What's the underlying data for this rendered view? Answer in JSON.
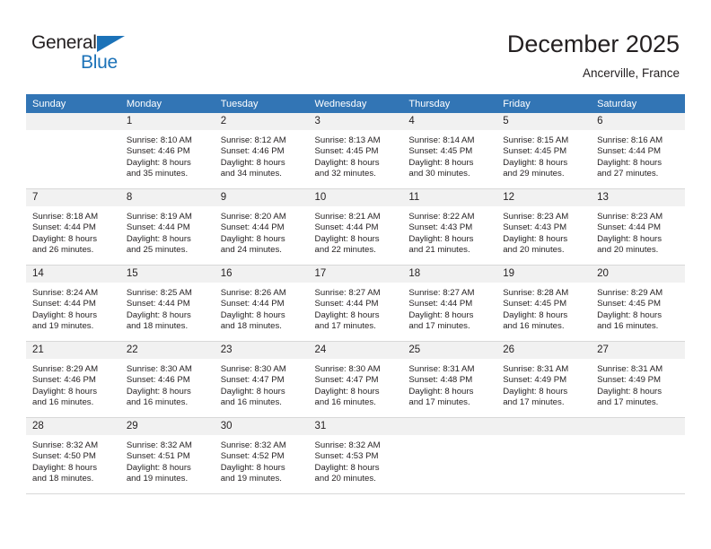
{
  "brand": {
    "name_part1": "General",
    "name_part2": "Blue",
    "triangle_color": "#1b72b8",
    "text_color": "#231f20"
  },
  "header": {
    "month_title": "December 2025",
    "location": "Ancerville, France"
  },
  "theme": {
    "header_row_bg": "#3275b5",
    "header_row_text": "#ffffff",
    "daynum_bg": "#f1f1f1",
    "grid_line": "#d8d8d8",
    "body_text": "#231f20"
  },
  "weekday_headers": [
    "Sunday",
    "Monday",
    "Tuesday",
    "Wednesday",
    "Thursday",
    "Friday",
    "Saturday"
  ],
  "weeks": [
    [
      {
        "day": "",
        "blank": true,
        "lines": []
      },
      {
        "day": "1",
        "lines": [
          "Sunrise: 8:10 AM",
          "Sunset: 4:46 PM",
          "Daylight: 8 hours",
          "and 35 minutes."
        ]
      },
      {
        "day": "2",
        "lines": [
          "Sunrise: 8:12 AM",
          "Sunset: 4:46 PM",
          "Daylight: 8 hours",
          "and 34 minutes."
        ]
      },
      {
        "day": "3",
        "lines": [
          "Sunrise: 8:13 AM",
          "Sunset: 4:45 PM",
          "Daylight: 8 hours",
          "and 32 minutes."
        ]
      },
      {
        "day": "4",
        "lines": [
          "Sunrise: 8:14 AM",
          "Sunset: 4:45 PM",
          "Daylight: 8 hours",
          "and 30 minutes."
        ]
      },
      {
        "day": "5",
        "lines": [
          "Sunrise: 8:15 AM",
          "Sunset: 4:45 PM",
          "Daylight: 8 hours",
          "and 29 minutes."
        ]
      },
      {
        "day": "6",
        "lines": [
          "Sunrise: 8:16 AM",
          "Sunset: 4:44 PM",
          "Daylight: 8 hours",
          "and 27 minutes."
        ]
      }
    ],
    [
      {
        "day": "7",
        "lines": [
          "Sunrise: 8:18 AM",
          "Sunset: 4:44 PM",
          "Daylight: 8 hours",
          "and 26 minutes."
        ]
      },
      {
        "day": "8",
        "lines": [
          "Sunrise: 8:19 AM",
          "Sunset: 4:44 PM",
          "Daylight: 8 hours",
          "and 25 minutes."
        ]
      },
      {
        "day": "9",
        "lines": [
          "Sunrise: 8:20 AM",
          "Sunset: 4:44 PM",
          "Daylight: 8 hours",
          "and 24 minutes."
        ]
      },
      {
        "day": "10",
        "lines": [
          "Sunrise: 8:21 AM",
          "Sunset: 4:44 PM",
          "Daylight: 8 hours",
          "and 22 minutes."
        ]
      },
      {
        "day": "11",
        "lines": [
          "Sunrise: 8:22 AM",
          "Sunset: 4:43 PM",
          "Daylight: 8 hours",
          "and 21 minutes."
        ]
      },
      {
        "day": "12",
        "lines": [
          "Sunrise: 8:23 AM",
          "Sunset: 4:43 PM",
          "Daylight: 8 hours",
          "and 20 minutes."
        ]
      },
      {
        "day": "13",
        "lines": [
          "Sunrise: 8:23 AM",
          "Sunset: 4:44 PM",
          "Daylight: 8 hours",
          "and 20 minutes."
        ]
      }
    ],
    [
      {
        "day": "14",
        "lines": [
          "Sunrise: 8:24 AM",
          "Sunset: 4:44 PM",
          "Daylight: 8 hours",
          "and 19 minutes."
        ]
      },
      {
        "day": "15",
        "lines": [
          "Sunrise: 8:25 AM",
          "Sunset: 4:44 PM",
          "Daylight: 8 hours",
          "and 18 minutes."
        ]
      },
      {
        "day": "16",
        "lines": [
          "Sunrise: 8:26 AM",
          "Sunset: 4:44 PM",
          "Daylight: 8 hours",
          "and 18 minutes."
        ]
      },
      {
        "day": "17",
        "lines": [
          "Sunrise: 8:27 AM",
          "Sunset: 4:44 PM",
          "Daylight: 8 hours",
          "and 17 minutes."
        ]
      },
      {
        "day": "18",
        "lines": [
          "Sunrise: 8:27 AM",
          "Sunset: 4:44 PM",
          "Daylight: 8 hours",
          "and 17 minutes."
        ]
      },
      {
        "day": "19",
        "lines": [
          "Sunrise: 8:28 AM",
          "Sunset: 4:45 PM",
          "Daylight: 8 hours",
          "and 16 minutes."
        ]
      },
      {
        "day": "20",
        "lines": [
          "Sunrise: 8:29 AM",
          "Sunset: 4:45 PM",
          "Daylight: 8 hours",
          "and 16 minutes."
        ]
      }
    ],
    [
      {
        "day": "21",
        "lines": [
          "Sunrise: 8:29 AM",
          "Sunset: 4:46 PM",
          "Daylight: 8 hours",
          "and 16 minutes."
        ]
      },
      {
        "day": "22",
        "lines": [
          "Sunrise: 8:30 AM",
          "Sunset: 4:46 PM",
          "Daylight: 8 hours",
          "and 16 minutes."
        ]
      },
      {
        "day": "23",
        "lines": [
          "Sunrise: 8:30 AM",
          "Sunset: 4:47 PM",
          "Daylight: 8 hours",
          "and 16 minutes."
        ]
      },
      {
        "day": "24",
        "lines": [
          "Sunrise: 8:30 AM",
          "Sunset: 4:47 PM",
          "Daylight: 8 hours",
          "and 16 minutes."
        ]
      },
      {
        "day": "25",
        "lines": [
          "Sunrise: 8:31 AM",
          "Sunset: 4:48 PM",
          "Daylight: 8 hours",
          "and 17 minutes."
        ]
      },
      {
        "day": "26",
        "lines": [
          "Sunrise: 8:31 AM",
          "Sunset: 4:49 PM",
          "Daylight: 8 hours",
          "and 17 minutes."
        ]
      },
      {
        "day": "27",
        "lines": [
          "Sunrise: 8:31 AM",
          "Sunset: 4:49 PM",
          "Daylight: 8 hours",
          "and 17 minutes."
        ]
      }
    ],
    [
      {
        "day": "28",
        "lines": [
          "Sunrise: 8:32 AM",
          "Sunset: 4:50 PM",
          "Daylight: 8 hours",
          "and 18 minutes."
        ]
      },
      {
        "day": "29",
        "lines": [
          "Sunrise: 8:32 AM",
          "Sunset: 4:51 PM",
          "Daylight: 8 hours",
          "and 19 minutes."
        ]
      },
      {
        "day": "30",
        "lines": [
          "Sunrise: 8:32 AM",
          "Sunset: 4:52 PM",
          "Daylight: 8 hours",
          "and 19 minutes."
        ]
      },
      {
        "day": "31",
        "lines": [
          "Sunrise: 8:32 AM",
          "Sunset: 4:53 PM",
          "Daylight: 8 hours",
          "and 20 minutes."
        ]
      },
      {
        "day": "",
        "blank": true,
        "lines": []
      },
      {
        "day": "",
        "blank": true,
        "lines": []
      },
      {
        "day": "",
        "blank": true,
        "lines": []
      }
    ]
  ]
}
